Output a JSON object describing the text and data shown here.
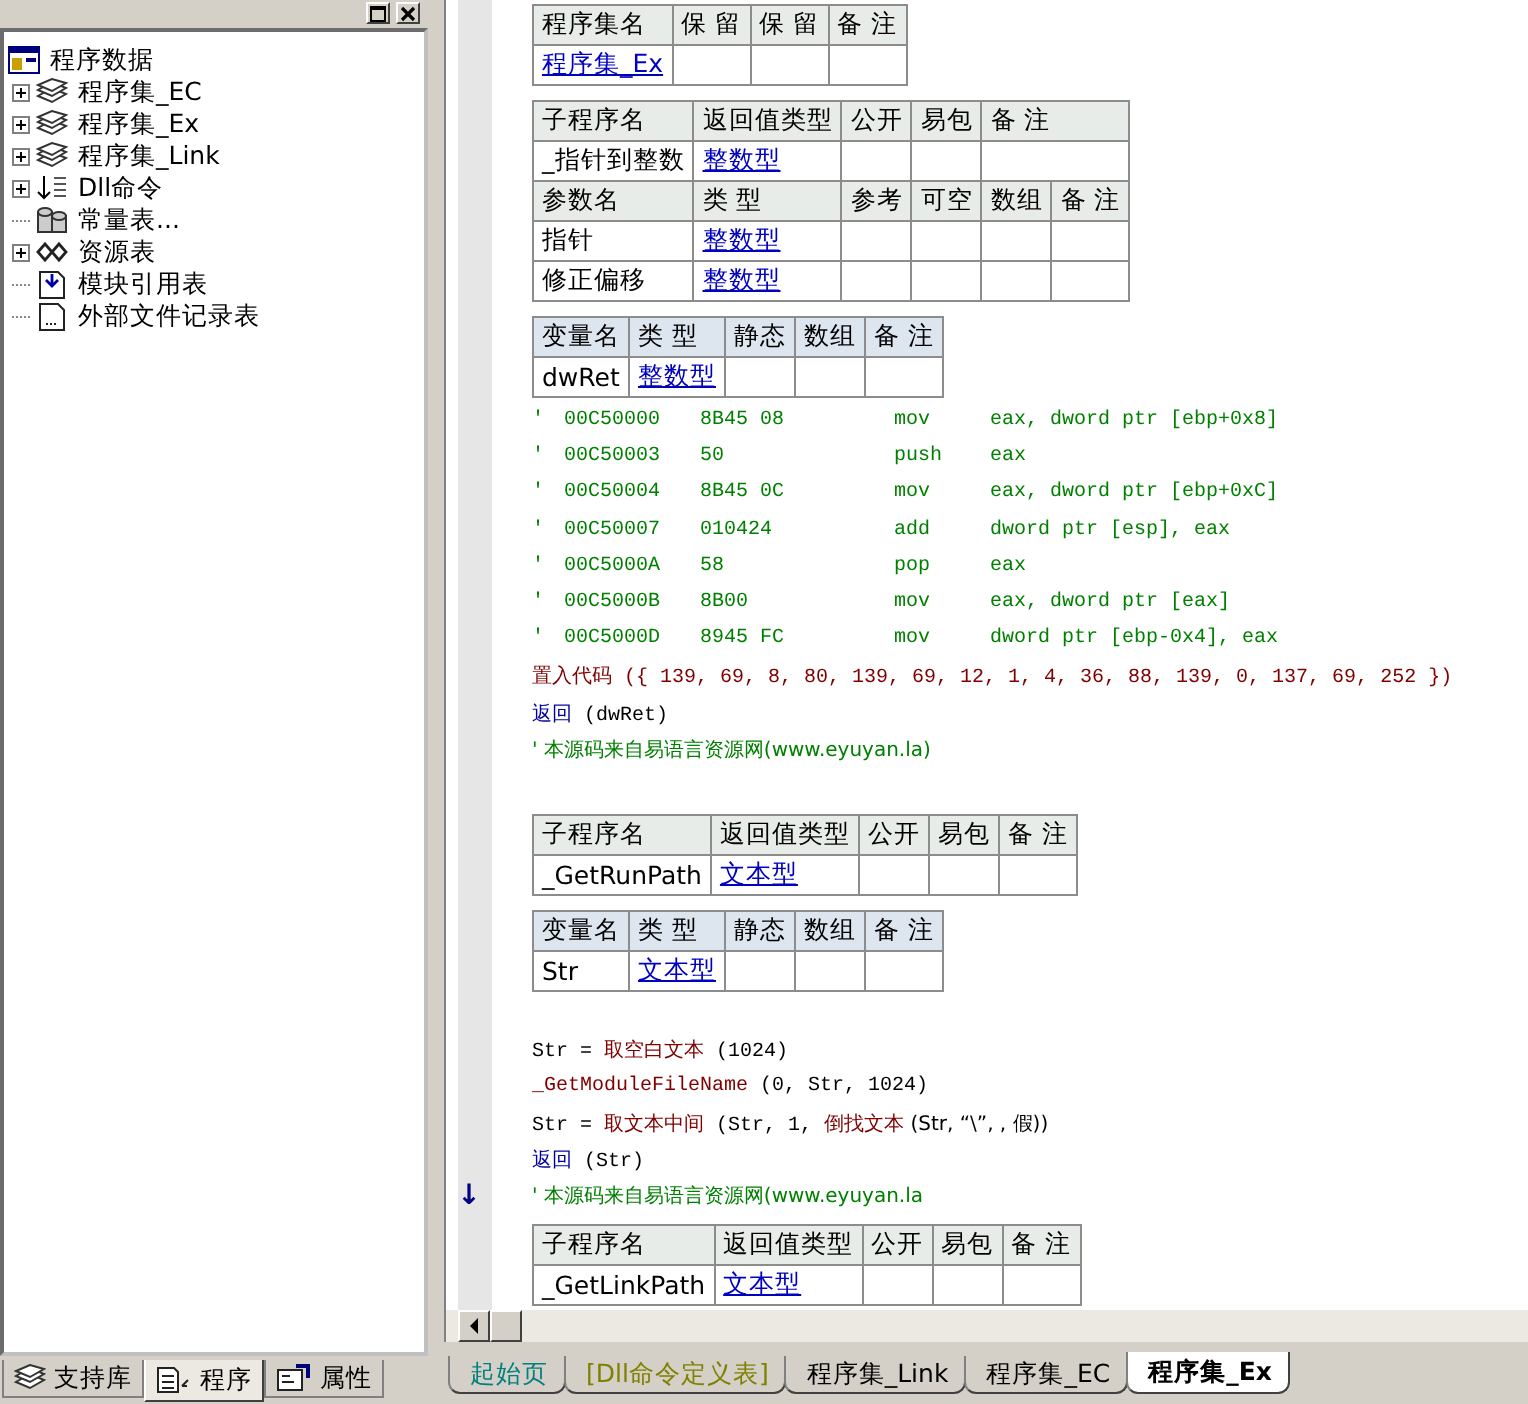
{
  "panel": {
    "tree": {
      "label": "程序数据",
      "kind": "project",
      "children": [
        {
          "label": "程序集_EC",
          "kind": "assembly",
          "expanded": false
        },
        {
          "label": "程序集_Ex",
          "kind": "assembly",
          "expanded": false
        },
        {
          "label": "程序集_Link",
          "kind": "assembly",
          "expanded": false
        },
        {
          "label": "Dll命令",
          "kind": "dll",
          "expanded": false
        },
        {
          "label": "常量表...",
          "kind": "constants"
        },
        {
          "label": "资源表",
          "kind": "resources",
          "expanded": false
        },
        {
          "label": "模块引用表",
          "kind": "module"
        },
        {
          "label": "外部文件记录表",
          "kind": "file"
        }
      ]
    },
    "tabs": [
      {
        "label": "支持库",
        "kind": "library",
        "selected": false
      },
      {
        "label": "程序",
        "kind": "program",
        "selected": true
      },
      {
        "label": "属性",
        "kind": "properties",
        "selected": false
      }
    ]
  },
  "editor": {
    "blocks": [
      {
        "kind": "assembly_table",
        "rows": [
          {
            "header": true,
            "cells": [
              {
                "text": "程序集名"
              },
              {
                "text": "保 留"
              },
              {
                "text": "保 留"
              },
              {
                "text": "备 注"
              }
            ]
          },
          {
            "header": false,
            "cells": [
              {
                "text": "程序集_Ex",
                "link": true
              },
              {},
              {},
              {}
            ]
          }
        ]
      },
      {
        "kind": "subprogram_table",
        "rows": [
          {
            "header": true,
            "cells": [
              {
                "text": "子程序名"
              },
              {
                "text": "返回值类型"
              },
              {
                "text": "公开"
              },
              {
                "text": "易包"
              },
              {
                "text": "备 注",
                "colspan": 2
              }
            ]
          },
          {
            "header": false,
            "cells": [
              {
                "text": "_指针到整数"
              },
              {
                "text": "整数型",
                "link": true
              },
              {},
              {},
              {
                "colspan": 2
              }
            ]
          },
          {
            "header": true,
            "cells": [
              {
                "text": "参数名"
              },
              {
                "text": "类 型"
              },
              {
                "text": "参考"
              },
              {
                "text": "可空"
              },
              {
                "text": "数组"
              },
              {
                "text": "备 注"
              }
            ]
          },
          {
            "header": false,
            "cells": [
              {
                "text": "指针"
              },
              {
                "text": "整数型",
                "link": true
              },
              {},
              {},
              {},
              {}
            ]
          },
          {
            "header": false,
            "cells": [
              {
                "text": "修正偏移"
              },
              {
                "text": "整数型",
                "link": true
              },
              {},
              {},
              {},
              {}
            ]
          }
        ]
      },
      {
        "kind": "variable_table",
        "rows": [
          {
            "header": true,
            "cells": [
              {
                "text": "变量名"
              },
              {
                "text": "类 型"
              },
              {
                "text": "静态"
              },
              {
                "text": "数组"
              },
              {
                "text": "备 注"
              }
            ]
          },
          {
            "header": false,
            "cells": [
              {
                "text": "dwRet"
              },
              {
                "text": "整数型",
                "link": true
              },
              {},
              {},
              {}
            ]
          }
        ]
      },
      {
        "kind": "asm",
        "cols": [
          "'",
          "00C50000",
          "8B45 08",
          "mov",
          "eax, dword ptr [ebp+0x8]"
        ]
      },
      {
        "kind": "asm",
        "cols": [
          "'",
          "00C50003",
          "50",
          "push",
          "eax"
        ]
      },
      {
        "kind": "asm",
        "cols": [
          "'",
          "00C50004",
          "8B45 0C",
          "mov",
          "eax, dword ptr [ebp+0xC]"
        ]
      },
      {
        "kind": "asm",
        "cols": [
          "'",
          "00C50007",
          "010424",
          "add",
          "dword ptr [esp], eax"
        ]
      },
      {
        "kind": "asm",
        "cols": [
          "'",
          "00C5000A",
          "58",
          "pop",
          "eax"
        ]
      },
      {
        "kind": "asm",
        "cols": [
          "'",
          "00C5000B",
          "8B00",
          "mov",
          "eax, dword ptr [eax]"
        ]
      },
      {
        "kind": "asm",
        "cols": [
          "'",
          "00C5000D",
          "8945 FC",
          "mov",
          "dword ptr [ebp-0x4], eax"
        ]
      },
      {
        "kind": "code",
        "segments": [
          {
            "kind": "func",
            "text": "置入代码"
          },
          {
            "kind": "number",
            "text": " ({ 139, 69, 8, 80, 139, 69, 12, 1, 4, 36, 88, 139, 0, 137, 69, 252 })"
          }
        ]
      },
      {
        "kind": "code",
        "segments": [
          {
            "kind": "keyword",
            "text": "返回"
          },
          {
            "kind": "plain",
            "text": " (dwRet)"
          }
        ]
      },
      {
        "kind": "code",
        "segments": [
          {
            "kind": "comment",
            "text": "' 本源码来自易语言资源网(www.eyuyan.la)"
          }
        ]
      },
      {
        "kind": "blank"
      },
      {
        "kind": "subprogram_table",
        "rows": [
          {
            "header": true,
            "cells": [
              {
                "text": "子程序名"
              },
              {
                "text": "返回值类型"
              },
              {
                "text": "公开"
              },
              {
                "text": "易包"
              },
              {
                "text": "备 注"
              }
            ]
          },
          {
            "header": false,
            "cells": [
              {
                "text": "_GetRunPath"
              },
              {
                "text": "文本型",
                "link": true
              },
              {},
              {},
              {}
            ]
          }
        ]
      },
      {
        "kind": "variable_table",
        "rows": [
          {
            "header": true,
            "cells": [
              {
                "text": "变量名"
              },
              {
                "text": "类 型"
              },
              {
                "text": "静态"
              },
              {
                "text": "数组"
              },
              {
                "text": "备 注"
              }
            ]
          },
          {
            "header": false,
            "cells": [
              {
                "text": "Str"
              },
              {
                "text": "文本型",
                "link": true
              },
              {},
              {},
              {}
            ]
          }
        ]
      },
      {
        "kind": "blank"
      },
      {
        "kind": "code",
        "segments": [
          {
            "kind": "plain",
            "text": "Str = "
          },
          {
            "kind": "func",
            "text": "取空白文本"
          },
          {
            "kind": "plain",
            "text": " (1024)"
          }
        ]
      },
      {
        "kind": "code",
        "segments": [
          {
            "kind": "func",
            "text": "_GetModuleFileName"
          },
          {
            "kind": "plain",
            "text": " (0, Str, 1024)"
          }
        ]
      },
      {
        "kind": "code",
        "segments": [
          {
            "kind": "plain",
            "text": "Str = "
          },
          {
            "kind": "func",
            "text": "取文本中间"
          },
          {
            "kind": "plain",
            "text": " (Str, 1, "
          },
          {
            "kind": "func",
            "text": "倒找文本"
          },
          {
            "kind": "plain",
            "text": " (Str, “\\”, , 假))"
          }
        ]
      },
      {
        "kind": "code",
        "segments": [
          {
            "kind": "keyword",
            "text": "返回"
          },
          {
            "kind": "plain",
            "text": " (Str)"
          }
        ]
      },
      {
        "kind": "code",
        "marker": "↓",
        "segments": [
          {
            "kind": "comment",
            "text": "' 本源码来自易语言资源网(www.eyuyan.la"
          }
        ]
      },
      {
        "kind": "subprogram_table",
        "rows": [
          {
            "header": true,
            "cells": [
              {
                "text": "子程序名"
              },
              {
                "text": "返回值类型"
              },
              {
                "text": "公开"
              },
              {
                "text": "易包"
              },
              {
                "text": "备 注"
              }
            ]
          },
          {
            "header": false,
            "cells": [
              {
                "text": "_GetLinkPath"
              },
              {
                "text": "文本型",
                "link": true
              },
              {},
              {},
              {}
            ]
          }
        ]
      }
    ]
  },
  "doc_tabs": [
    {
      "label": "起始页",
      "color": "#008080",
      "selected": false
    },
    {
      "label": "[Dll命令定义表]",
      "color": "#808000",
      "selected": false
    },
    {
      "label": "程序集_Link",
      "color": "#000000",
      "selected": false
    },
    {
      "label": "程序集_EC",
      "color": "#000000",
      "selected": false
    },
    {
      "label": "程序集_Ex",
      "color": "#000000",
      "selected": true
    }
  ]
}
